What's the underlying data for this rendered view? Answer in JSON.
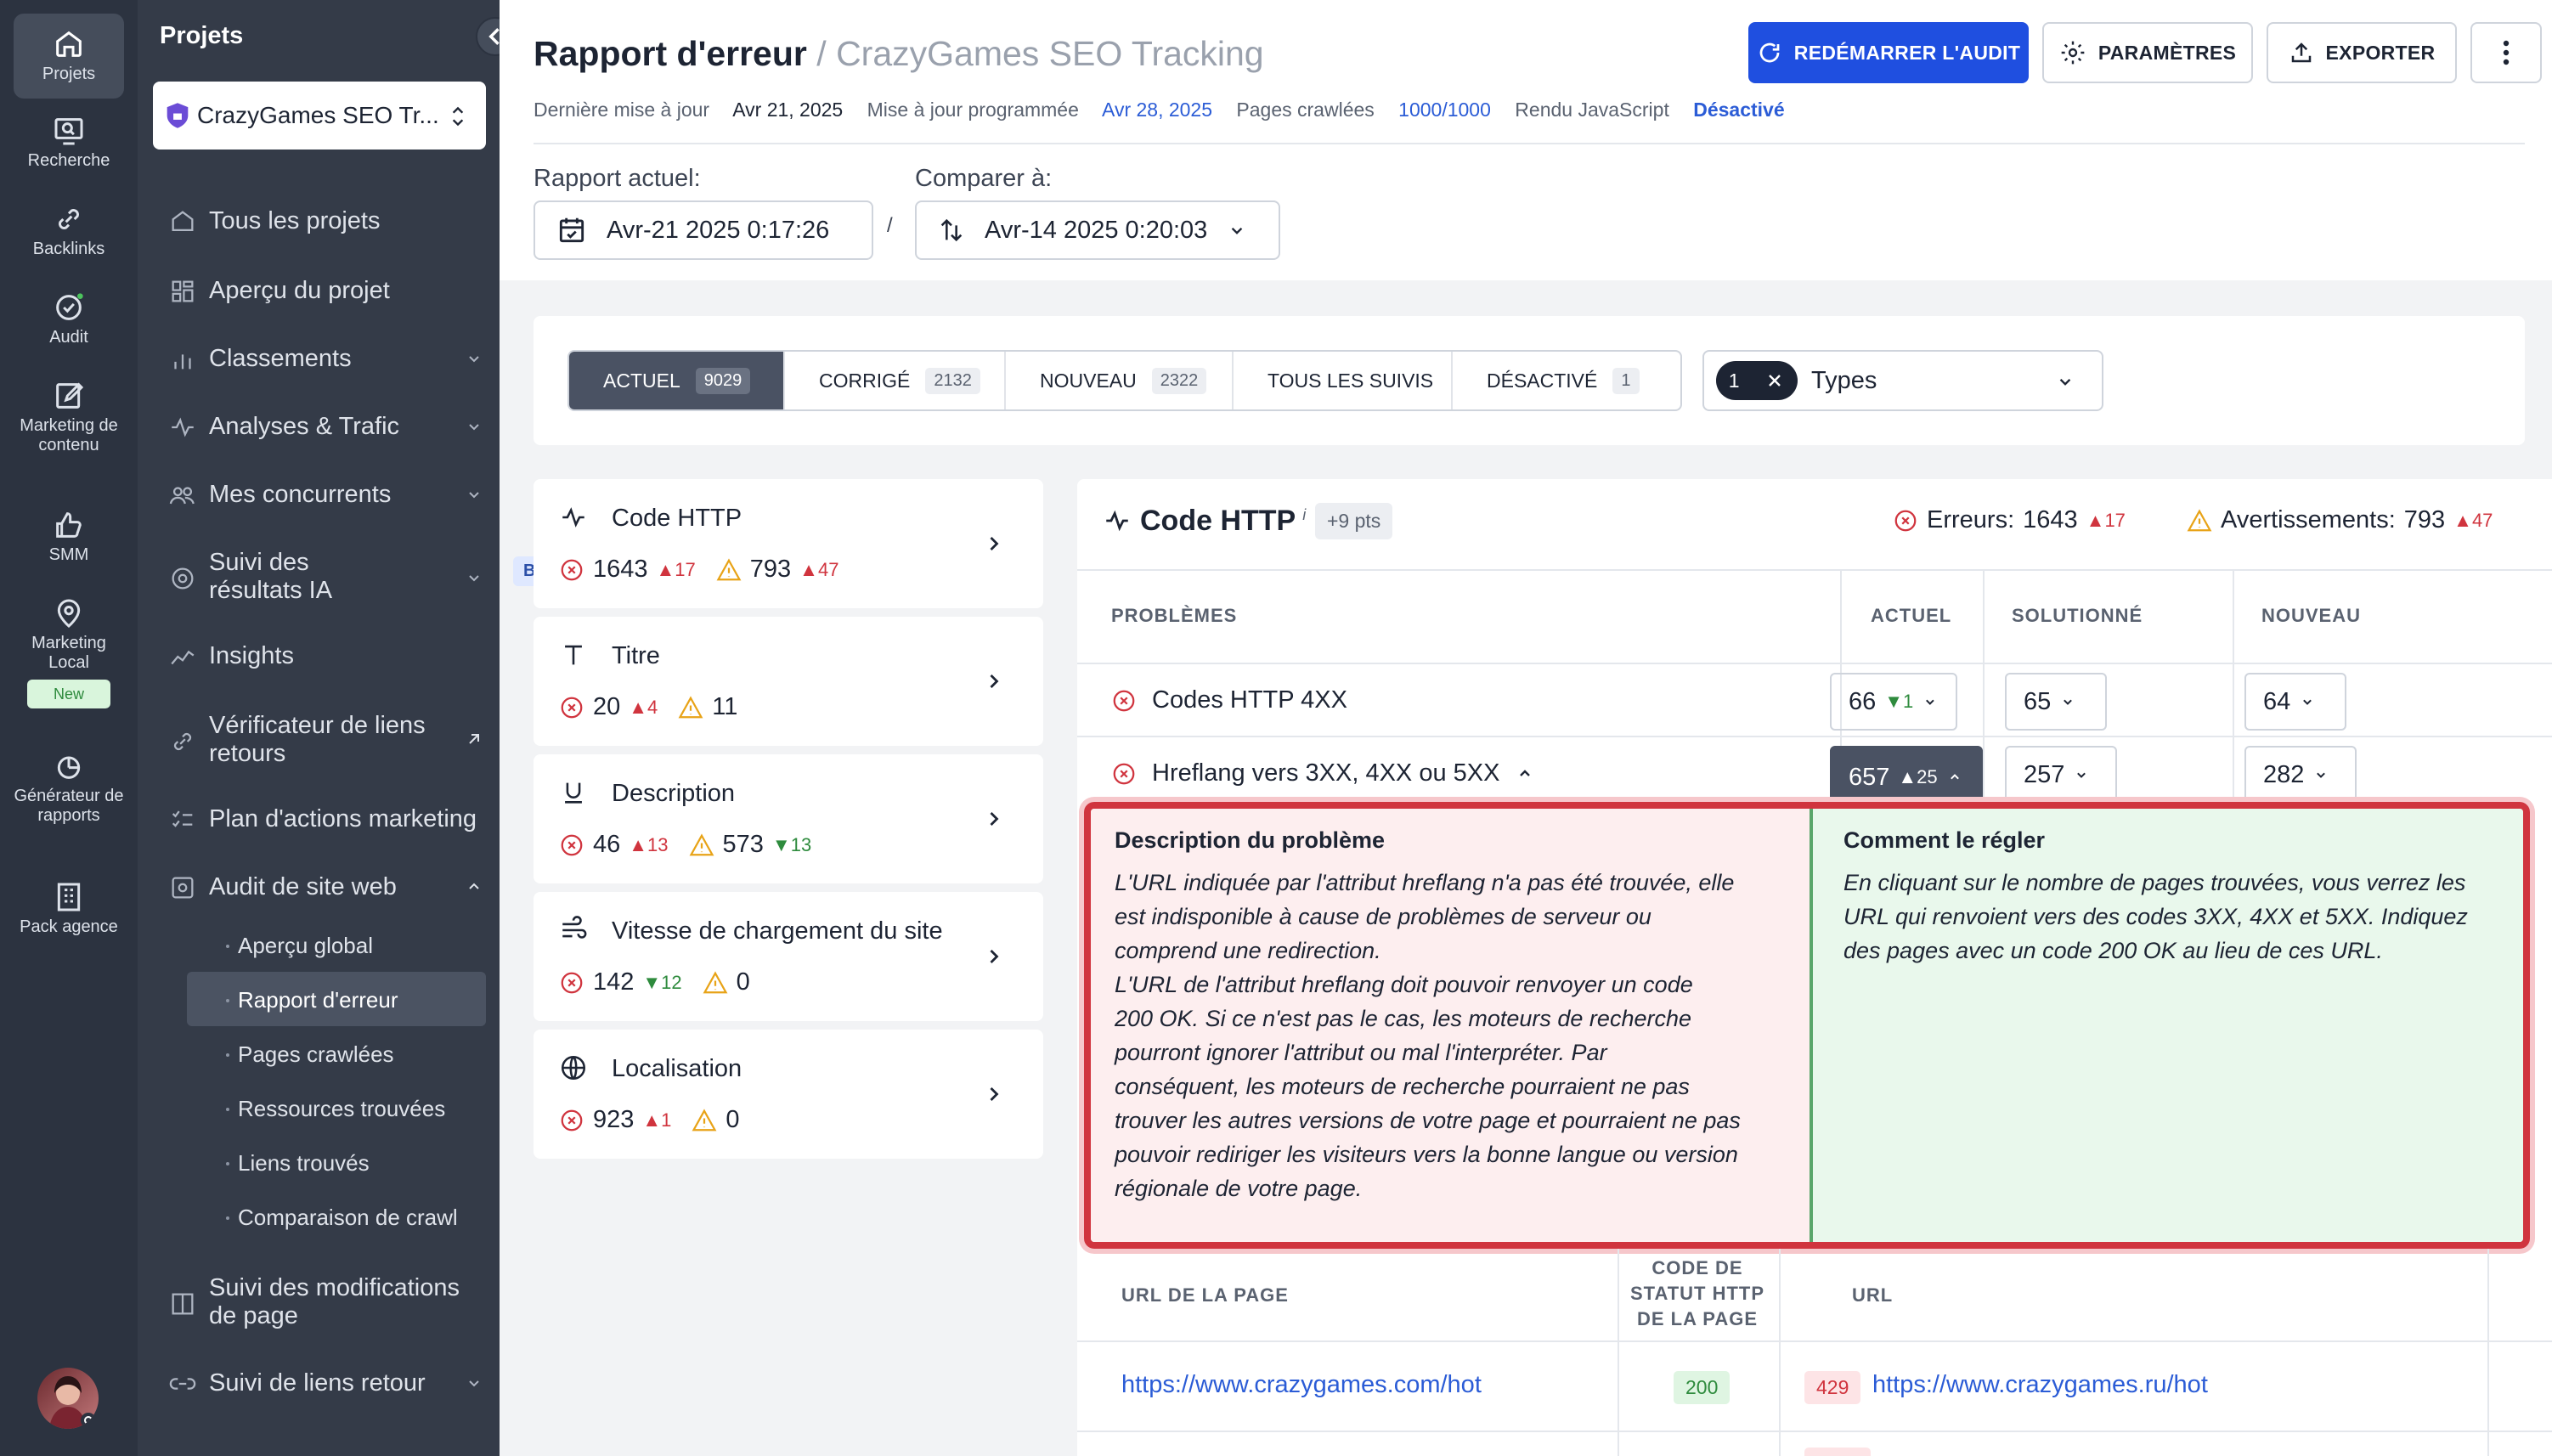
{
  "rail": [
    {
      "label": "Projets",
      "icon": "home-icon",
      "active": true
    },
    {
      "label": "Recherche",
      "icon": "search-monitor-icon"
    },
    {
      "label": "Backlinks",
      "icon": "link-icon"
    },
    {
      "label": "Audit",
      "icon": "audit-check-icon"
    },
    {
      "label": "Marketing de contenu",
      "icon": "edit-icon"
    },
    {
      "label": "SMM",
      "icon": "thumb-up-icon"
    },
    {
      "label": "Marketing Local",
      "icon": "map-pin-icon",
      "badge": "New"
    },
    {
      "label": "Générateur de rapports",
      "icon": "report-icon"
    },
    {
      "label": "Pack agence",
      "icon": "building-icon"
    }
  ],
  "sidebar": {
    "title": "Projets",
    "project": "CrazyGames SEO Tr...",
    "items": [
      {
        "label": "Tous les projets",
        "icon": "home-icon"
      },
      {
        "label": "Aperçu du projet",
        "icon": "grid-icon"
      },
      {
        "label": "Classements",
        "icon": "bar-chart-icon"
      },
      {
        "label": "Analyses & Trafic",
        "icon": "pulse-icon"
      },
      {
        "label": "Mes concurrents",
        "icon": "users-icon"
      },
      {
        "label": "Suivi des résultats IA",
        "icon": "ai-icon",
        "badge": "Beta"
      },
      {
        "label": "Insights",
        "icon": "sparkline-icon"
      },
      {
        "label": "Vérificateur de liens retours",
        "icon": "link-icon"
      },
      {
        "label": "Plan d'actions marketing",
        "icon": "checklist-icon"
      },
      {
        "label": "Audit de site web",
        "icon": "audit-icon"
      },
      {
        "label": "Suivi des modifications de page",
        "icon": "compare-icon"
      },
      {
        "label": "Suivi de liens retour",
        "icon": "link-icon"
      }
    ],
    "subitems": [
      "Aperçu global",
      "Rapport d'erreur",
      "Pages crawlées",
      "Ressources trouvées",
      "Liens trouvés",
      "Comparaison de crawl"
    ]
  },
  "header": {
    "title": "Rapport d'erreur",
    "sep": "/",
    "project": "CrazyGames SEO Tracking",
    "buttons": {
      "restart": "REDÉMARRER L'AUDIT",
      "settings": "PARAMÈTRES",
      "export": "EXPORTER"
    },
    "meta": {
      "last_update_label": "Dernière mise à jour",
      "last_update": "Avr 21, 2025",
      "scheduled_label": "Mise à jour programmée",
      "scheduled": "Avr 28, 2025",
      "crawled_label": "Pages crawlées",
      "crawled": "1000/1000",
      "js_label": "Rendu JavaScript",
      "js": "Désactivé"
    },
    "current_label": "Rapport actuel:",
    "current": "Avr-21 2025 0:17:26",
    "slash": "/",
    "compare_label": "Comparer à:",
    "compare": "Avr-14 2025 0:20:03"
  },
  "filters": {
    "tabs": [
      {
        "label": "ACTUEL",
        "count": "9029",
        "active": true
      },
      {
        "label": "CORRIGÉ",
        "count": "2132"
      },
      {
        "label": "NOUVEAU",
        "count": "2322"
      },
      {
        "label": "TOUS LES SUIVIS",
        "count": ""
      },
      {
        "label": "DÉSACTIVÉ",
        "count": "1"
      }
    ],
    "types_count": "1",
    "types_label": "Types"
  },
  "categories": [
    {
      "title": "Code HTTP",
      "icon": "pulse-icon",
      "err": "1643",
      "err_delta": "17",
      "err_dir": "up",
      "warn": "793",
      "warn_delta": "47",
      "warn_dir": "up"
    },
    {
      "title": "Titre",
      "icon": "title-icon",
      "err": "20",
      "err_delta": "4",
      "err_dir": "up",
      "warn": "11",
      "warn_delta": "",
      "warn_dir": ""
    },
    {
      "title": "Description",
      "icon": "underline-icon",
      "err": "46",
      "err_delta": "13",
      "err_dir": "up",
      "warn": "573",
      "warn_delta": "13",
      "warn_dir": "down"
    },
    {
      "title": "Vitesse de chargement du site",
      "icon": "speed-icon",
      "err": "142",
      "err_delta": "12",
      "err_dir": "down",
      "warn": "0",
      "warn_delta": "",
      "warn_dir": ""
    },
    {
      "title": "Localisation",
      "icon": "globe-icon",
      "err": "923",
      "err_delta": "1",
      "err_dir": "up",
      "warn": "0",
      "warn_delta": "",
      "warn_dir": ""
    }
  ],
  "panel": {
    "title": "Code HTTP",
    "info": "i",
    "points": "+9 pts",
    "errors_label": "Erreurs:",
    "errors": "1643",
    "errors_delta": "17",
    "warnings_label": "Avertissements:",
    "warnings": "793",
    "warnings_delta": "47",
    "columns": [
      "PROBLÈMES",
      "ACTUEL",
      "SOLUTIONNÉ",
      "NOUVEAU"
    ],
    "rows": [
      {
        "name": "Codes HTTP 4XX",
        "current": "66",
        "current_delta": "1",
        "current_dir": "down",
        "solved": "65",
        "new": "64"
      },
      {
        "name": "Hreflang vers 3XX, 4XX ou 5XX",
        "current": "657",
        "current_delta": "25",
        "current_dir": "up",
        "solved": "257",
        "new": "282"
      }
    ],
    "explain": {
      "desc_title": "Description du problème",
      "desc": "L'URL indiquée par l'attribut hreflang n'a pas été trouvée, elle\nest indisponible à cause de problèmes de serveur ou\ncomprend une redirection.\nL'URL de l'attribut hreflang doit pouvoir renvoyer un code\n200 OK. Si ce n'est pas le cas, les moteurs de recherche\npourront ignorer l'attribut ou mal l'interpréter. Par\nconséquent, les moteurs de recherche pourraient ne pas\ntrouver les autres versions de votre page et pourraient ne pas\npouvoir rediriger les visiteurs vers la bonne langue ou version\nrégionale de votre page.",
      "fix_title": "Comment le régler",
      "fix": "En cliquant sur le nombre de pages trouvées, vous verrez les\nURL qui renvoient vers des codes 3XX, 4XX et 5XX. Indiquez\ndes pages avec un code 200 OK au lieu de ces URL."
    },
    "url_columns": {
      "page": "URL DE LA PAGE",
      "status": "CODE DE\nSTATUT HTTP\nDE LA PAGE",
      "url": "URL"
    },
    "url_rows": [
      {
        "page": "https://www.crazygames.com/hot",
        "status": "200",
        "code": "429",
        "url": "https://www.crazygames.ru/hot"
      }
    ]
  },
  "colors": {
    "primary": "#1f4fe0",
    "error": "#d0343e",
    "success": "#2e8b3d",
    "warning": "#e8a317",
    "sidebar": "#343b48"
  }
}
